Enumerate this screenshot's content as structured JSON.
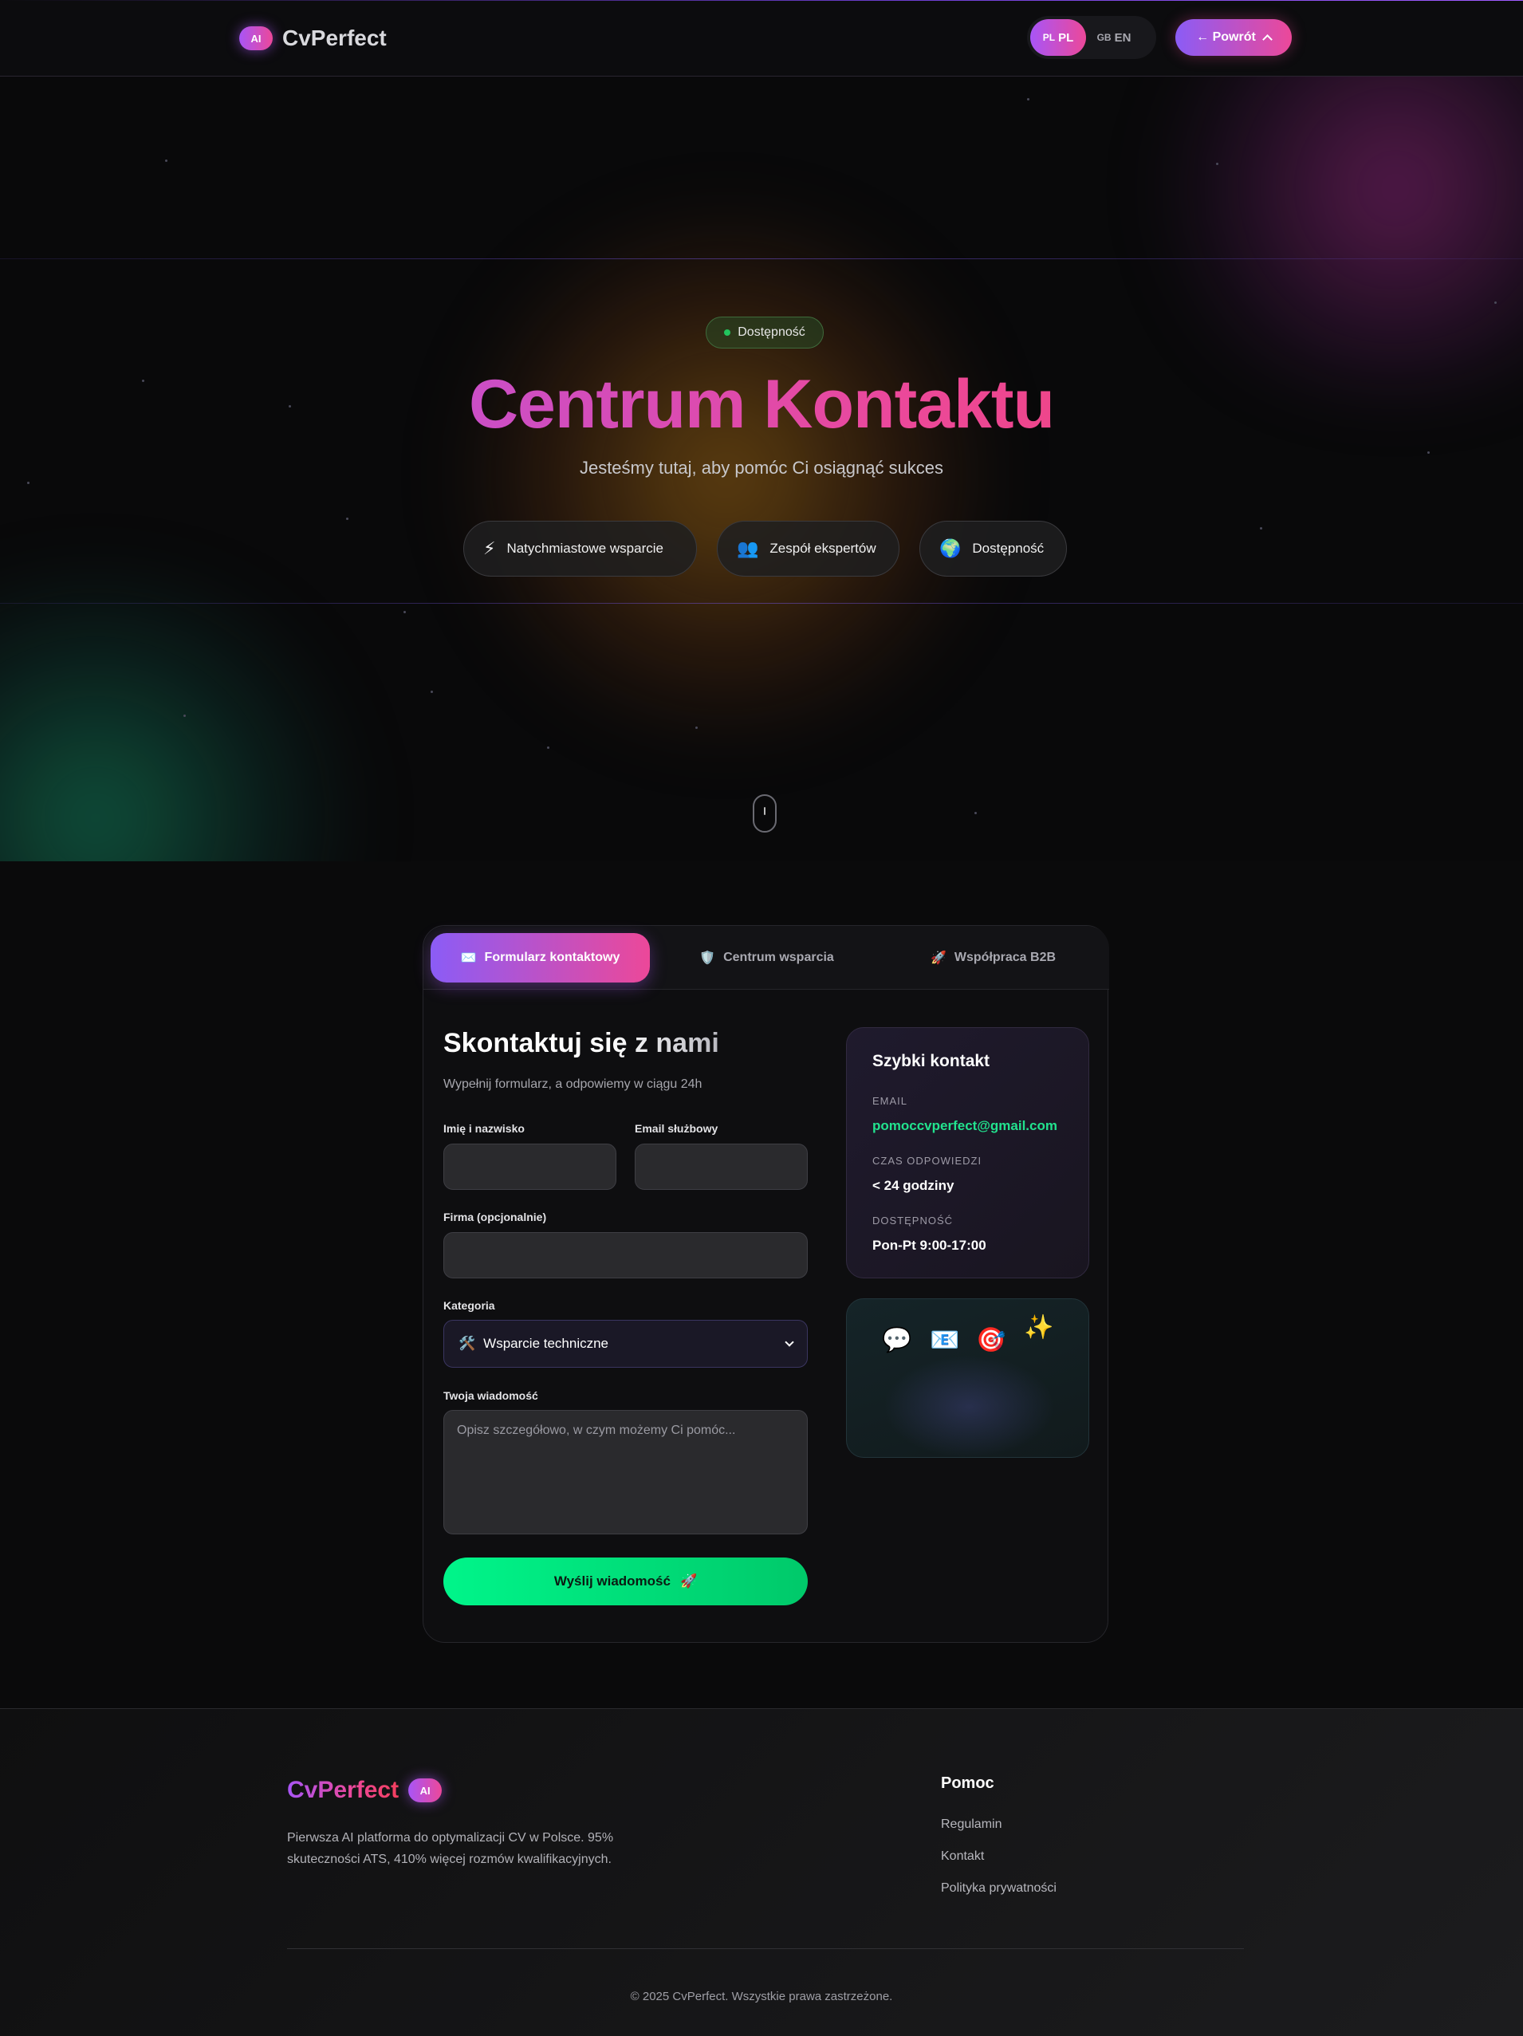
{
  "nav": {
    "ai_badge": "AI",
    "brand": "CvPerfect",
    "languages": [
      {
        "flag": "PL",
        "code": "PL",
        "active": true
      },
      {
        "flag": "GB",
        "code": "EN",
        "active": false
      }
    ],
    "back_label": "← Powrót",
    "back_icon": "^"
  },
  "hero": {
    "badge": "Dostępność",
    "title": "Centrum Kontaktu",
    "subtitle": "Jesteśmy tutaj, aby pomóc Ci osiągnąć sukces",
    "features": [
      {
        "icon": "⚡",
        "icon_name": "lightning-icon",
        "label": "Natychmiastowe wsparcie"
      },
      {
        "icon": "👥",
        "icon_name": "team-icon",
        "label": "Zespół ekspertów"
      },
      {
        "icon": "🌍",
        "icon_name": "globe-icon",
        "label": "Dostępność"
      }
    ]
  },
  "tabs": [
    {
      "icon": "✉️",
      "icon_name": "envelope-icon",
      "label": "Formularz kontaktowy",
      "active": true
    },
    {
      "icon": "🛡️",
      "icon_name": "shield-icon",
      "label": "Centrum wsparcia",
      "active": false
    },
    {
      "icon": "🚀",
      "icon_name": "rocket-icon",
      "label": "Współpraca B2B",
      "active": false
    }
  ],
  "form": {
    "title": "Skontaktuj się z nami",
    "subtitle": "Wypełnij formularz, a odpowiemy w ciągu 24h",
    "name_label": "Imię i nazwisko",
    "email_label": "Email służbowy",
    "company_label": "Firma (opcjonalnie)",
    "category_label": "Kategoria",
    "category_icon": "🛠️",
    "category_value": "Wsparcie techniczne",
    "message_label": "Twoja wiadomość",
    "message_placeholder": "Opisz szczegółowo, w czym możemy Ci pomóc...",
    "send_label": "Wyślij wiadomość",
    "send_icon": "🚀"
  },
  "quick_contact": {
    "title": "Szybki kontakt",
    "email_label": "EMAIL",
    "email_value": "pomoccvperfect@gmail.com",
    "response_label": "CZAS ODPOWIEDZI",
    "response_value": "< 24 godziny",
    "availability_label": "DOSTĘPNOŚĆ",
    "availability_value": "Pon-Pt 9:00-17:00"
  },
  "emoji_panel": [
    "💬",
    "📧",
    "🎯",
    "✨"
  ],
  "footer": {
    "brand": "CvPerfect",
    "ai_badge": "AI",
    "description": "Pierwsza AI platforma do optymalizacji CV w Polsce. 95% skuteczności ATS, 410% więcej rozmów kwalifikacyjnych.",
    "help_title": "Pomoc",
    "links": [
      "Regulamin",
      "Kontakt",
      "Polityka prywatności"
    ],
    "copyright": "© 2025 CvPerfect. Wszystkie prawa zastrzeżone."
  },
  "colors": {
    "accent_purple": "#8b5cf6",
    "accent_pink": "#ec4899",
    "success_green": "#00f58a",
    "email_green": "#22e28e",
    "background": "#0a0a0b"
  }
}
